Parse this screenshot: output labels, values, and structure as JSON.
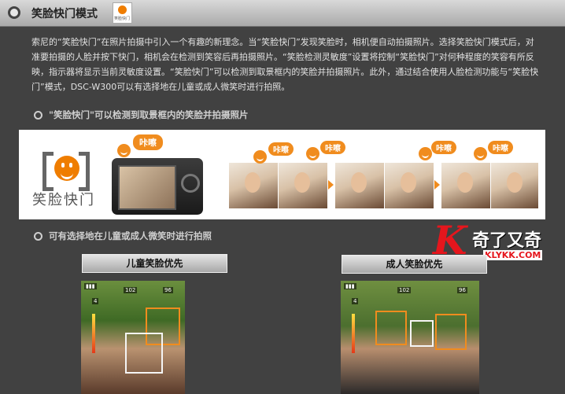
{
  "header": {
    "title": "笑脸快门模式",
    "logo_caption": "笑脸快门"
  },
  "intro": {
    "text": "索尼的“笑脸快门”在照片拍摄中引入一个有趣的新理念。当“笑脸快门”发现笑脸时，相机便自动拍摄照片。选择笑脸快门模式后，对准要拍摄的人脸并按下快门，相机会在检测到笑容后再拍摄照片。“笑脸检测灵敏度”设置将控制“笑脸快门”对何种程度的笑容有所反映，指示器将显示当前灵敏度设置。“笑脸快门”可以检测到取景框内的笑脸并拍摄照片。此外，通过结合使用人脸检测功能与“笑脸快门”模式，DSC-W300可以有选择地在儿童或成人微笑时进行拍照。"
  },
  "sections": [
    {
      "heading": "\"笑脸快门\"可以检测到取景框内的笑脸并拍摄照片"
    },
    {
      "heading": "可有选择地在儿童或成人微笑时进行拍照"
    }
  ],
  "banner": {
    "label": "笑脸快门",
    "bubble_text": "咔嚓"
  },
  "buttons": {
    "child_priority": "儿童笑脸优先",
    "adult_priority": "成人笑脸优先"
  },
  "osd": {
    "kids": {
      "number": "102",
      "count": "96",
      "level": "4"
    },
    "adults": {
      "number": "102",
      "count": "96",
      "level": "4"
    }
  },
  "watermark": {
    "letter": "K",
    "name": "奇了又奇",
    "url": "KLYKK.COM"
  },
  "colors": {
    "background": "#414141",
    "accent_orange": "#f08c1e",
    "watermark_red": "#e5161d"
  }
}
